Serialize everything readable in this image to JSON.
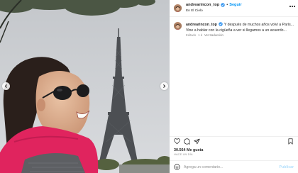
{
  "post": {
    "username": "andrearincon_top",
    "follow_label": "Seguir",
    "location": "En El Cielo",
    "caption_text": "Y después de muchos años volví a París... Vine a hablar con la cigüeña a ver si llegamos a un acuerdo...",
    "caption_time": "Editado",
    "caption_age": "1 d",
    "see_translation": "Ver traducción",
    "likes": "30.564 Me gusta",
    "date": "HACE UN DÍA"
  },
  "comment": {
    "placeholder": "Agrega un comentario...",
    "publish_label": "Publicar"
  },
  "icons": {
    "verified": "verified-badge-icon",
    "like": "heart-icon",
    "comment": "comment-bubble-icon",
    "share": "paper-plane-icon",
    "save": "bookmark-icon",
    "emoji": "emoji-smile-icon",
    "more": "more-options-icon",
    "carousel_prev": "chevron-left-icon",
    "carousel_next": "chevron-right-icon"
  },
  "colors": {
    "accent": "#0095f6",
    "verified": "#3897f0",
    "publish_disabled": "#b2dffc",
    "jacket": "#e0245e"
  }
}
